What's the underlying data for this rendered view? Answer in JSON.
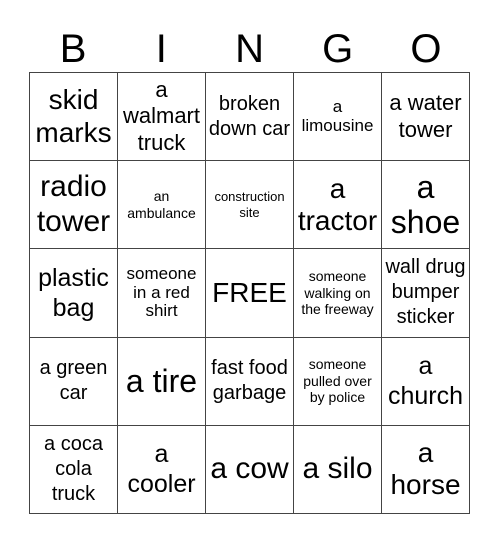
{
  "header": [
    "B",
    "I",
    "N",
    "G",
    "O"
  ],
  "cells": [
    "skid marks",
    "a walmart truck",
    "broken down car",
    "a limousine",
    "a water tower",
    "radio tower",
    "an ambulance",
    "construction site",
    "a tractor",
    "a shoe",
    "plastic bag",
    "someone in a red shirt",
    "FREE",
    "someone walking on the freeway",
    "wall drug bumper sticker",
    "a green car",
    "a tire",
    "fast food garbage",
    "someone pulled over by police",
    "a church",
    "a coca cola truck",
    "a cooler",
    "a cow",
    "a silo",
    "a horse"
  ]
}
